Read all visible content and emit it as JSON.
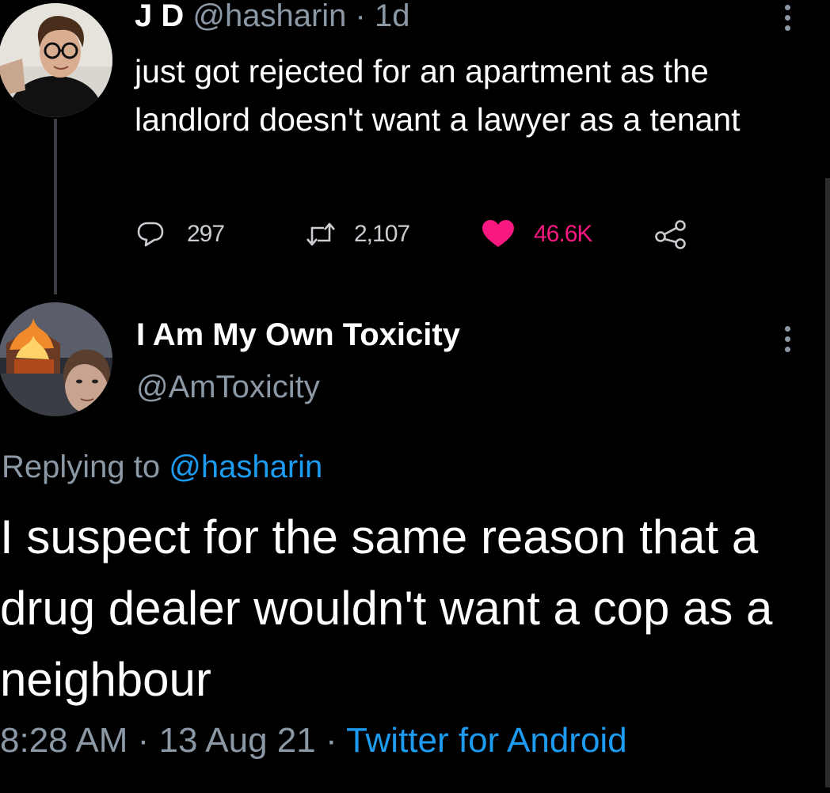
{
  "tweet1": {
    "name": "J D",
    "handle": "@hasharin",
    "separator": "·",
    "age": "1d",
    "text": "just got rejected for an apartment as the landlord doesn't want a lawyer as a tenant",
    "replies": "297",
    "retweets": "2,107",
    "likes": "46.6K",
    "icons": {
      "reply": "reply-icon",
      "retweet": "retweet-icon",
      "like": "heart-icon",
      "share": "share-icon",
      "more": "more-vertical-icon"
    }
  },
  "tweet2": {
    "name": "I Am My Own Toxicity",
    "handle": "@AmToxicity",
    "replying_prefix": "Replying to ",
    "replying_handle": "@hasharin",
    "text": "I suspect for the same reason that a drug dealer wouldn't want a cop as a neighbour",
    "time": "8:28 AM",
    "sep": " · ",
    "date": "13 Aug 21",
    "sep2": " · ",
    "source": "Twitter for Android"
  },
  "colors": {
    "background": "#000000",
    "text": "#ffffff",
    "muted": "#8b98a5",
    "link": "#1d9bf0",
    "like": "#f91880",
    "thread_line": "#3a3d41"
  }
}
